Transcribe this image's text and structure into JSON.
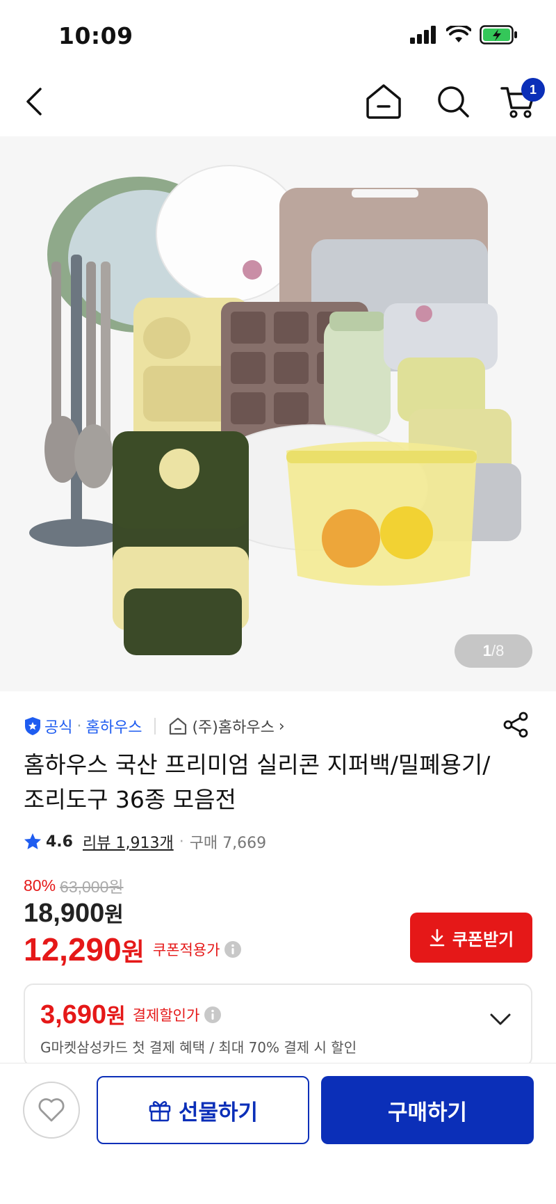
{
  "status_bar": {
    "time": "10:09"
  },
  "nav": {
    "cart_count": "1"
  },
  "gallery": {
    "current": "1",
    "separator": "/",
    "total": "8"
  },
  "seller": {
    "official_label": "공식",
    "dot": "·",
    "name": "홈하우스",
    "store_name": "(주)홈하우스",
    "store_chevron": "›"
  },
  "product": {
    "title": "홈하우스 국산 프리미엄 실리콘 지퍼백/밀폐용기/조리도구 36종 모음전",
    "rating": "4.6",
    "review_label": "리뷰 1,913개",
    "dot": "·",
    "sales_label": "구매 7,669"
  },
  "price": {
    "discount_rate": "80%",
    "original_price": "63,000원",
    "sale_price": "18,900",
    "sale_unit": "원",
    "coupon_price": "12,290",
    "coupon_unit": "원",
    "coupon_label": "쿠폰적용가",
    "coupon_button": "쿠폰받기"
  },
  "card_discount": {
    "amount": "3,690",
    "unit": "원",
    "label": "결제할인가",
    "description": "G마켓삼성카드 첫 결제 혜택 / 최대 70% 결제 시 할인"
  },
  "bottom_bar": {
    "gift_label": "선물하기",
    "buy_label": "구매하기"
  },
  "colors": {
    "accent_blue": "#0b2fb8",
    "sale_red": "#e51818",
    "link_blue": "#1e5cf0"
  },
  "icons": [
    "back-icon",
    "home-icon",
    "search-icon",
    "cart-icon",
    "shield-check-icon",
    "store-icon",
    "share-icon",
    "star-icon",
    "info-icon",
    "download-icon",
    "chevron-down-icon",
    "heart-icon",
    "gift-icon"
  ]
}
